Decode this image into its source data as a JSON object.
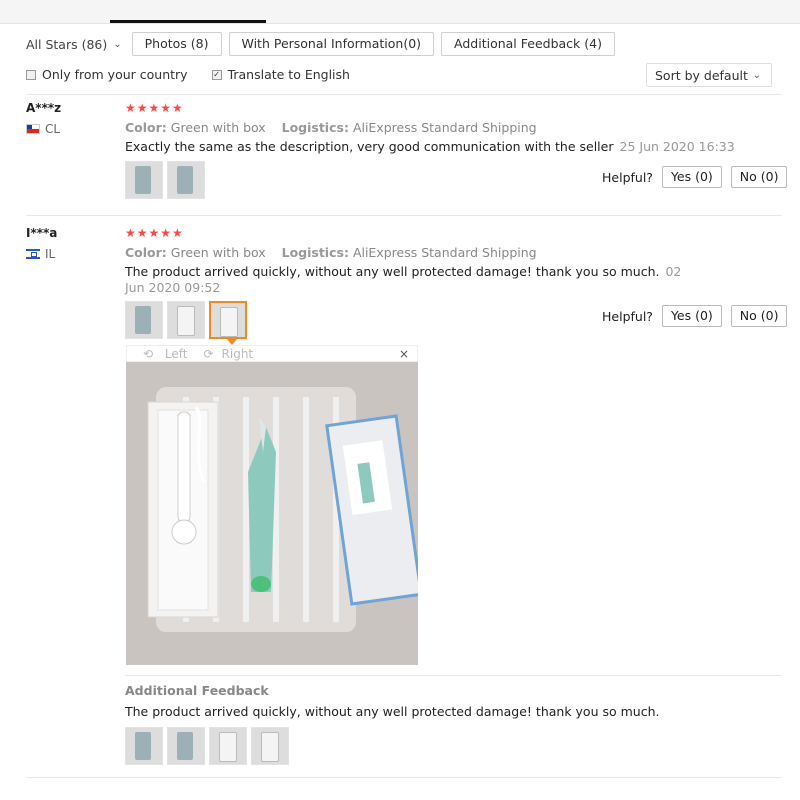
{
  "filters": {
    "all_stars": "All Stars (86)",
    "buttons": [
      "Photos (8)",
      "With Personal Information(0)",
      "Additional Feedback (4)"
    ]
  },
  "options": {
    "only_country": "Only from your country",
    "only_country_checked": false,
    "translate": "Translate to English",
    "translate_checked": true,
    "sort": "Sort by default"
  },
  "reviews": [
    {
      "user": "A***z",
      "country": "CL",
      "stars": "★★★★★",
      "color_label": "Color:",
      "color_value": "Green with box",
      "logistics_label": "Logistics:",
      "logistics_value": "AliExpress Standard Shipping",
      "text": "Exactly the same as the description, very good communication with the seller",
      "date": "25 Jun 2020 16:33",
      "helpful_label": "Helpful?",
      "yes": "Yes (0)",
      "no": "No (0)"
    },
    {
      "user": "I***a",
      "country": "IL",
      "stars": "★★★★★",
      "color_label": "Color:",
      "color_value": "Green with box",
      "logistics_label": "Logistics:",
      "logistics_value": "AliExpress Standard Shipping",
      "text": "The product arrived quickly, without any well protected damage! thank you so much.",
      "date": "02 Jun 2020 09:52",
      "helpful_label": "Helpful?",
      "yes": "Yes (0)",
      "no": "No (0)",
      "viewer": {
        "left": "Left",
        "right": "Right",
        "close": "×"
      },
      "additional_title": "Additional Feedback",
      "additional_text": "The product arrived quickly, without any well protected damage! thank you so much."
    }
  ],
  "icons": {
    "chevron": "chevron-down-icon",
    "rotate_left": "rotate-left-icon",
    "rotate_right": "rotate-right-icon",
    "close": "close-icon"
  },
  "colors": {
    "star": "#ff4747",
    "active_thumb": "#f08a24"
  }
}
